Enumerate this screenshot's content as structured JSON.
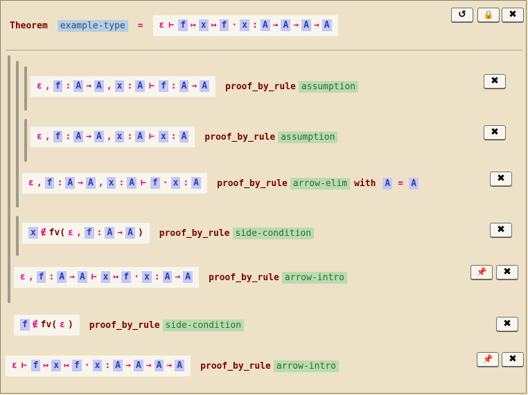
{
  "header": {
    "keyword": "Theorem",
    "name": "example-type",
    "eq": "=",
    "judgement": [
      "ε",
      "⊢",
      "f",
      "↦",
      "x",
      "↦",
      "f",
      "·",
      "x",
      ":",
      "A",
      "→",
      "A",
      "→",
      "A",
      "→",
      "A"
    ]
  },
  "buttons": {
    "reset": "↺",
    "lock": "🔒",
    "close": "✖",
    "pin": "📌"
  },
  "rows": [
    {
      "seq": [
        "ε",
        ",",
        "f",
        ":",
        "A",
        "→",
        "A",
        ",",
        "x",
        ":",
        "A",
        "⊢",
        "f",
        ":",
        "A",
        "→",
        "A"
      ],
      "keyword": "proof_by_rule",
      "rule": "assumption"
    },
    {
      "seq": [
        "ε",
        ",",
        "f",
        ":",
        "A",
        "→",
        "A",
        ",",
        "x",
        ":",
        "A",
        "⊢",
        "x",
        ":",
        "A"
      ],
      "keyword": "proof_by_rule",
      "rule": "assumption"
    },
    {
      "seq": [
        "ε",
        ",",
        "f",
        ":",
        "A",
        "→",
        "A",
        ",",
        "x",
        ":",
        "A",
        "⊢",
        "f",
        "·",
        "x",
        ":",
        "A"
      ],
      "keyword": "proof_by_rule",
      "rule": "arrow-elim",
      "with": "with",
      "with_lhs": "A",
      "with_eq": "=",
      "with_rhs": "A"
    },
    {
      "seq": [
        "x",
        "∉",
        "fv(",
        "ε",
        ",",
        "f",
        ":",
        "A",
        "→",
        "A",
        ")"
      ],
      "keyword": "proof_by_rule",
      "rule": "side-condition"
    },
    {
      "seq": [
        "ε",
        ",",
        "f",
        ":",
        "A",
        "→",
        "A",
        "⊢",
        "x",
        "↦",
        "f",
        "·",
        "x",
        ":",
        "A",
        "→",
        "A"
      ],
      "keyword": "proof_by_rule",
      "rule": "arrow-intro"
    },
    {
      "seq": [
        "f",
        "∉",
        "fv(",
        "ε",
        ")"
      ],
      "keyword": "proof_by_rule",
      "rule": "side-condition"
    },
    {
      "seq": [
        "ε",
        "⊢",
        "f",
        "↦",
        "x",
        "↦",
        "f",
        "·",
        "x",
        ":",
        "A",
        "→",
        "A",
        "→",
        "A",
        "→",
        "A"
      ],
      "keyword": "proof_by_rule",
      "rule": "arrow-intro"
    }
  ]
}
